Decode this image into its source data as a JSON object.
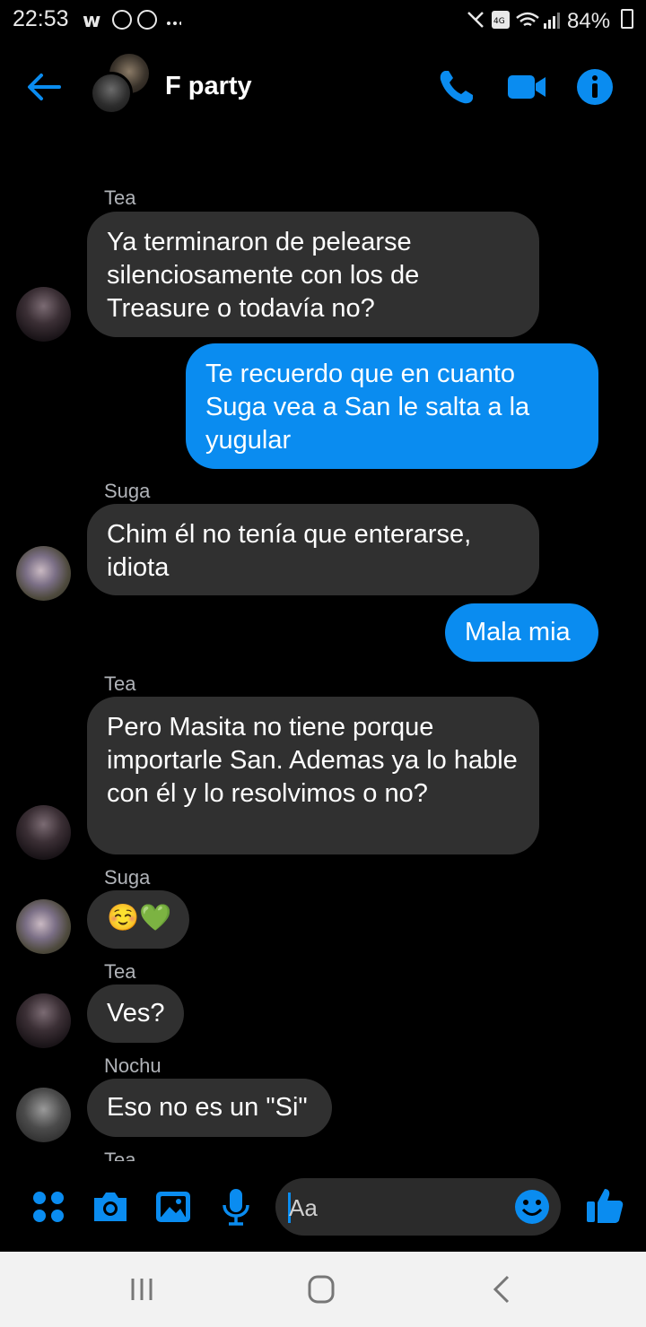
{
  "status_bar": {
    "time": "22:53",
    "left_icons": "w ✌ ◎ ···",
    "right_icons": "🔇 VoLTE 4G ▾ ▂▄▆",
    "battery": "84%"
  },
  "header": {
    "title": "F party",
    "back_icon": "back-arrow-icon",
    "call_icon": "phone-icon",
    "video_icon": "video-camera-icon",
    "info_icon": "info-icon"
  },
  "messages": [
    {
      "sender": "Tea",
      "direction": "in",
      "text": "Ya terminaron de pelearse silenciosamente con los de Treasure o todavía no?"
    },
    {
      "direction": "out",
      "text": "Te recuerdo que en cuanto Suga vea a San le salta a la yugular"
    },
    {
      "sender": "Suga",
      "direction": "in",
      "text": "Chim él no tenía que enterarse, idiota"
    },
    {
      "direction": "out",
      "text": "Mala mia"
    },
    {
      "sender": "Tea",
      "direction": "in",
      "text": "Pero Masita no tiene porque importarle San. Ademas ya lo hable con él y lo resolvimos o no?"
    },
    {
      "sender": "Suga",
      "direction": "in",
      "text": "☺️💚"
    },
    {
      "sender": "Tea",
      "direction": "in",
      "text": "Ves?"
    },
    {
      "sender": "Nochu",
      "direction": "in",
      "text": "Eso no es un \"Si\""
    },
    {
      "sender": "Tea",
      "direction": "in",
      "text": ""
    }
  ],
  "composer": {
    "placeholder": "Aa",
    "icons": [
      "apps-icon",
      "camera-icon",
      "gallery-icon",
      "microphone-icon",
      "emoji-icon",
      "thumbs-up-icon"
    ]
  },
  "colors": {
    "accent": "#0a8cf0",
    "incoming_bubble": "#303030",
    "background": "#000000"
  }
}
